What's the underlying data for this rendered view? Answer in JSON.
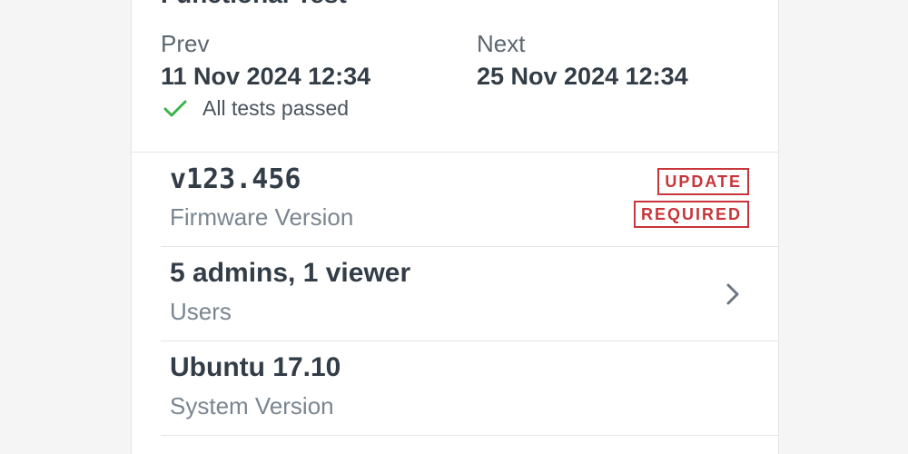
{
  "card": {
    "title": "Functional Test"
  },
  "schedule": {
    "prev_label": "Prev",
    "prev_date": "11 Nov 2024 12:34",
    "next_label": "Next",
    "next_date": "25 Nov 2024 12:34",
    "status_icon": "check-icon",
    "status_text": "All tests passed"
  },
  "rows": [
    {
      "value": "v123.456",
      "label": "Firmware Version",
      "badge_line1": "UPDATE",
      "badge_line2": "REQUIRED"
    },
    {
      "value": "5 admins, 1 viewer",
      "label": "Users",
      "icon": "chevron-right-icon"
    },
    {
      "value": "Ubuntu 17.10",
      "label": "System Version"
    }
  ],
  "colors": {
    "accent_success": "#3cb44a",
    "accent_warning": "#c8353a",
    "text_primary": "#333d47",
    "text_secondary": "#7a8590"
  }
}
